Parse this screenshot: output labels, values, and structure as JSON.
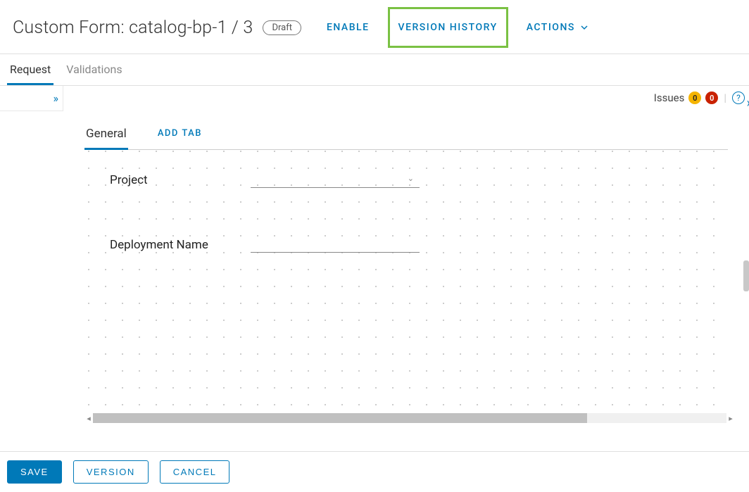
{
  "header": {
    "title": "Custom Form: catalog-bp-1 / 3",
    "status_badge": "Draft",
    "enable_label": "ENABLE",
    "version_history_label": "VERSION HISTORY",
    "actions_label": "ACTIONS"
  },
  "tabs": {
    "request": "Request",
    "validations": "Validations"
  },
  "issues": {
    "label": "Issues",
    "warning_count": "0",
    "error_count": "0"
  },
  "form_tabs": {
    "general": "General",
    "add_tab": "ADD TAB"
  },
  "fields": {
    "project_label": "Project",
    "deployment_name_label": "Deployment Name"
  },
  "footer": {
    "save": "SAVE",
    "version": "VERSION",
    "cancel": "CANCEL"
  }
}
